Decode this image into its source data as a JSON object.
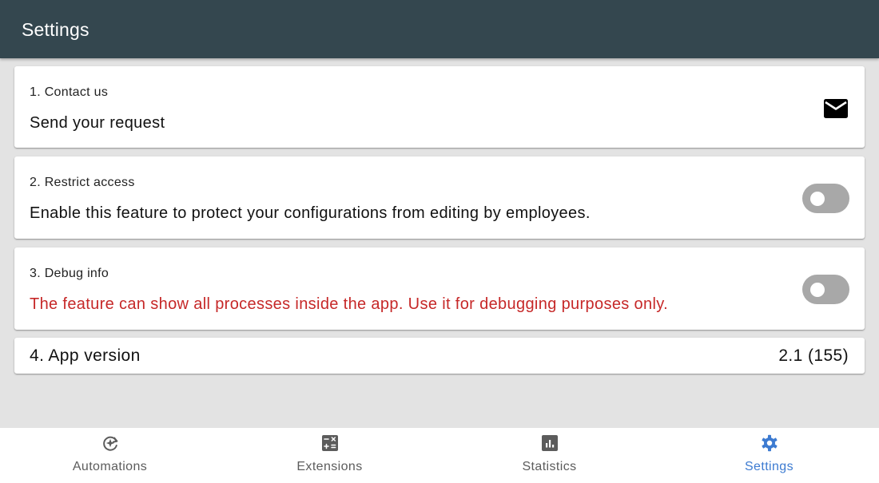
{
  "app_bar": {
    "title": "Settings"
  },
  "settings": {
    "contact": {
      "title": "1. Contact us",
      "description": "Send your request",
      "icon": "mail-icon"
    },
    "restrict_access": {
      "title": "2. Restrict access",
      "description": "Enable this feature to protect your configurations from editing by employees.",
      "enabled": false
    },
    "debug_info": {
      "title": "3. Debug info",
      "description": "The feature can show all processes inside the app. Use it for debugging purposes only.",
      "description_color": "#c62828",
      "enabled": false
    },
    "app_version": {
      "label": "4. App version",
      "value": "2.1 (155)"
    }
  },
  "bottom_nav": {
    "items": [
      {
        "label": "Automations",
        "icon": "automations-icon",
        "active": false
      },
      {
        "label": "Extensions",
        "icon": "calculator-icon",
        "active": false
      },
      {
        "label": "Statistics",
        "icon": "bar-chart-icon",
        "active": false
      },
      {
        "label": "Settings",
        "icon": "gear-icon",
        "active": true
      }
    ],
    "active_color": "#3d7bd1",
    "inactive_color": "#5c5c5c"
  },
  "colors": {
    "app_bar": "#34474f",
    "background": "#e3e3e3",
    "toggle_off": "#a8a8a8",
    "warning_text": "#c62828"
  }
}
